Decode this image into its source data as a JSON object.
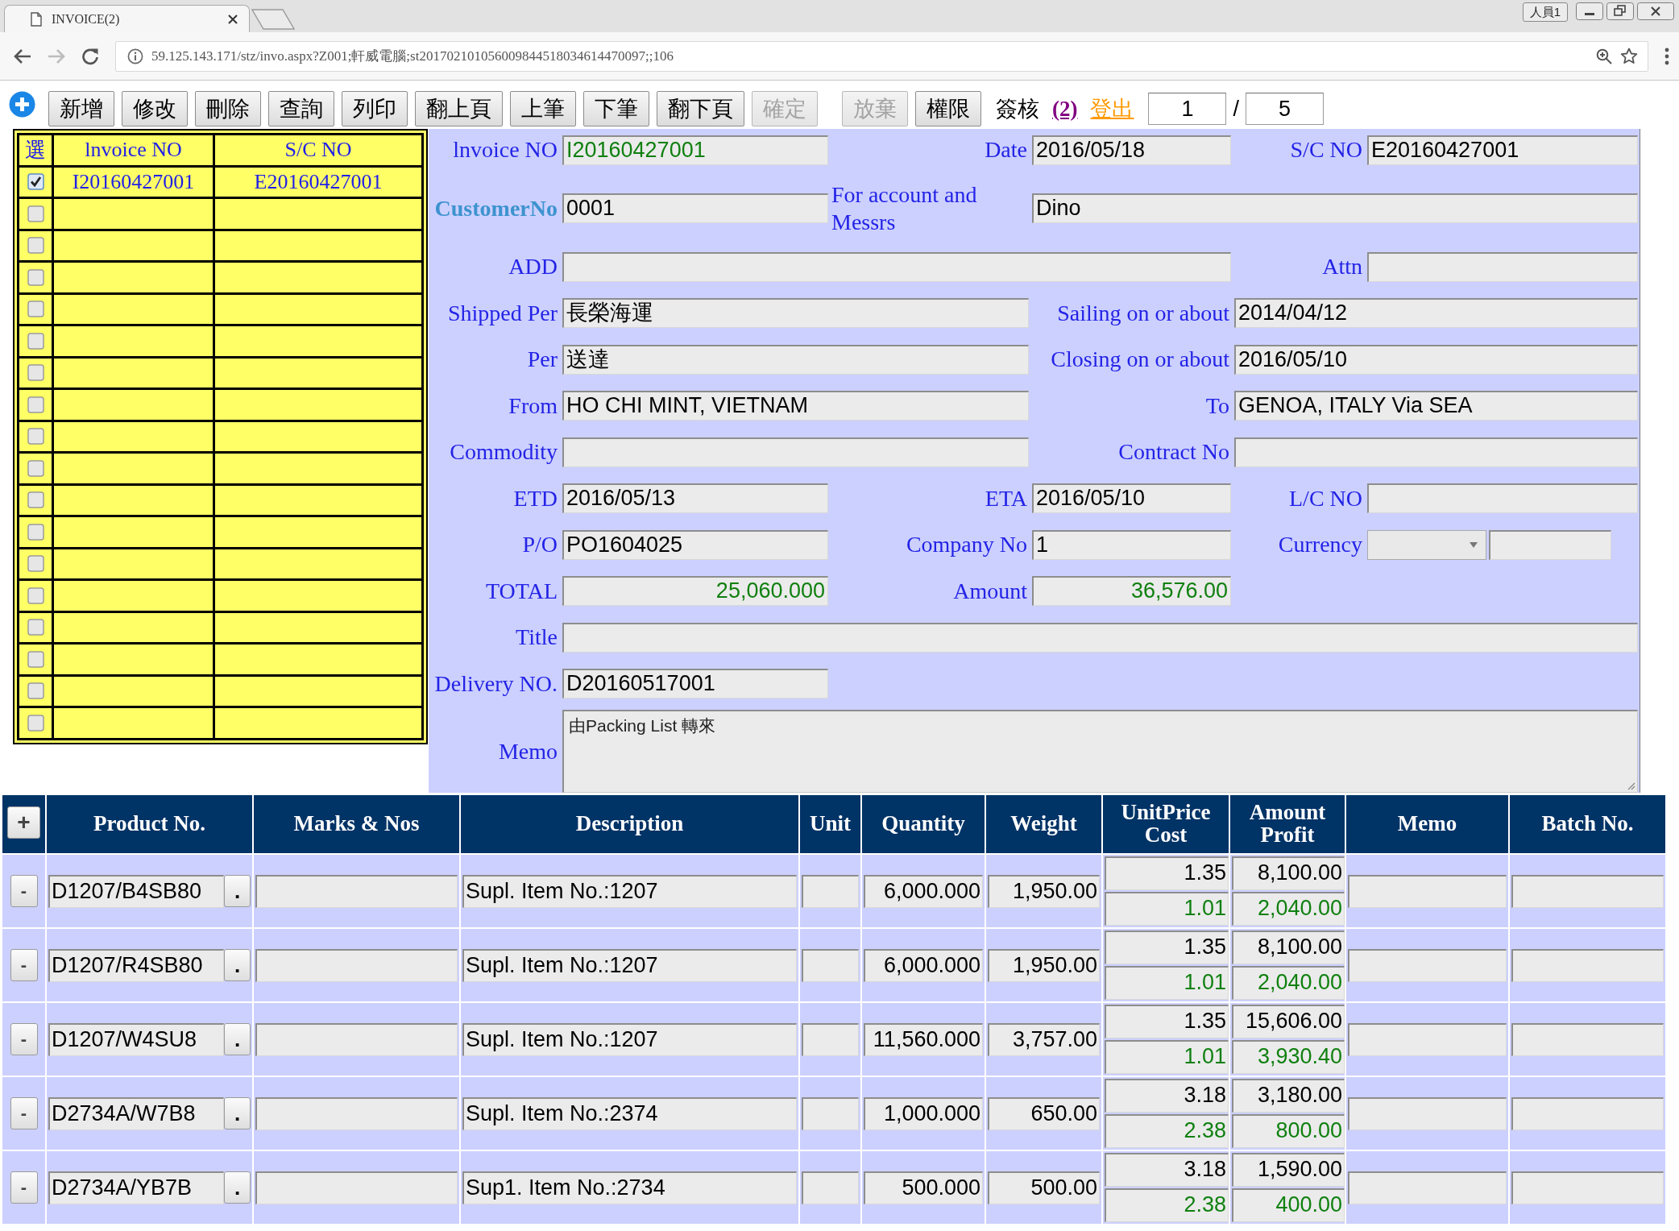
{
  "browser": {
    "tab_title": "INVOICE(2)",
    "profile": "人員1",
    "url": "59.125.143.171/stz/invo.aspx?Z001;軒威電腦;st201702101056009844518034614470097;;106"
  },
  "toolbar": {
    "buttons": [
      {
        "label": "新增",
        "disabled": false
      },
      {
        "label": "修改",
        "disabled": false
      },
      {
        "label": "刪除",
        "disabled": false
      },
      {
        "label": "查詢",
        "disabled": false
      },
      {
        "label": "列印",
        "disabled": false
      },
      {
        "label": "翻上頁",
        "disabled": false
      },
      {
        "label": "上筆",
        "disabled": false
      },
      {
        "label": "下筆",
        "disabled": false
      },
      {
        "label": "翻下頁",
        "disabled": false
      },
      {
        "label": "確定",
        "disabled": true
      },
      {
        "label": "放棄",
        "disabled": true
      },
      {
        "label": "權限",
        "disabled": false
      }
    ],
    "approval_label": "簽核",
    "links": [
      {
        "label": "(2)",
        "color": "#800080"
      },
      {
        "label": "登出",
        "color": "#ff9900"
      }
    ],
    "pager": {
      "current": "1",
      "separator": "/",
      "total": "5"
    }
  },
  "record_list": {
    "columns": [
      "選",
      "lnvoice NO",
      "S/C NO"
    ],
    "rows": [
      {
        "checked": true,
        "invoice_no": "I20160427001",
        "sc_no": "E20160427001"
      },
      {
        "checked": false
      },
      {
        "checked": false
      },
      {
        "checked": false
      },
      {
        "checked": false
      },
      {
        "checked": false
      },
      {
        "checked": false
      },
      {
        "checked": false
      },
      {
        "checked": false
      },
      {
        "checked": false
      },
      {
        "checked": false
      },
      {
        "checked": false
      },
      {
        "checked": false
      },
      {
        "checked": false
      },
      {
        "checked": false
      },
      {
        "checked": false
      },
      {
        "checked": false
      },
      {
        "checked": false
      }
    ]
  },
  "form": {
    "rows": [
      {
        "fields": [
          {
            "label": "lnvoice NO",
            "label_is_link": false,
            "value": "I20160427001",
            "kind": "text",
            "color": "#108010"
          },
          {
            "label": "Date",
            "label_is_link": false,
            "value": "2016/05/18",
            "kind": "text"
          },
          {
            "label": "S/C NO",
            "label_is_link": false,
            "value": "E20160427001",
            "kind": "text"
          }
        ]
      },
      {
        "fields": [
          {
            "label": "CustomerNo",
            "label_is_link": true,
            "value": "0001",
            "kind": "text"
          },
          {
            "label": "For account and Messrs",
            "label_is_link": false,
            "value": "Dino",
            "kind": "text"
          }
        ]
      },
      {
        "fields": [
          {
            "label": "ADD",
            "label_is_link": false,
            "kind": "text"
          },
          {
            "label": "Attn",
            "label_is_link": false,
            "kind": "text"
          }
        ]
      },
      {
        "fields": [
          {
            "label": "Shipped Per",
            "label_is_link": false,
            "value": "長榮海運",
            "kind": "text"
          },
          {
            "label": "Sailing on or about",
            "label_is_link": false,
            "value": "2014/04/12",
            "kind": "text"
          }
        ]
      },
      {
        "fields": [
          {
            "label": "Per",
            "label_is_link": false,
            "value": "送達",
            "kind": "text"
          },
          {
            "label": "Closing on or about",
            "label_is_link": false,
            "value": "2016/05/10",
            "kind": "text"
          }
        ]
      },
      {
        "fields": [
          {
            "label": "From",
            "label_is_link": false,
            "value": "HO CHI MINT, VIETNAM",
            "kind": "text"
          },
          {
            "label": "To",
            "label_is_link": false,
            "value": "GENOA, ITALY Via SEA",
            "kind": "text"
          }
        ]
      },
      {
        "fields": [
          {
            "label": "Commodity",
            "label_is_link": false,
            "kind": "text"
          },
          {
            "label": "Contract No",
            "label_is_link": false,
            "kind": "text"
          }
        ]
      },
      {
        "fields": [
          {
            "label": "ETD",
            "label_is_link": false,
            "value": "2016/05/13",
            "kind": "text"
          },
          {
            "label": "ETA",
            "label_is_link": false,
            "value": "2016/05/10",
            "kind": "text"
          },
          {
            "label": "L/C NO",
            "label_is_link": false,
            "kind": "text"
          }
        ]
      },
      {
        "fields": [
          {
            "label": "P/O",
            "label_is_link": false,
            "value": "PO1604025",
            "kind": "text"
          },
          {
            "label": "Company No",
            "label_is_link": false,
            "value": "1",
            "kind": "text"
          },
          {
            "label": "Currency",
            "label_is_link": false,
            "kind": "select"
          }
        ]
      },
      {
        "fields": [
          {
            "label": "TOTAL",
            "label_is_link": false,
            "value": "25,060.000",
            "kind": "number",
            "color": "#108010"
          },
          {
            "label": "Amount",
            "label_is_link": false,
            "value": "36,576.00",
            "kind": "number",
            "color": "#108010"
          }
        ]
      },
      {
        "fields": [
          {
            "label": "Title",
            "label_is_link": false,
            "kind": "text"
          }
        ]
      },
      {
        "fields": [
          {
            "label": "Delivery NO.",
            "label_is_link": false,
            "value": "D20160517001",
            "kind": "text"
          }
        ]
      },
      {
        "fields": [
          {
            "label": "Memo",
            "label_is_link": false,
            "value": "由Packing List 轉來",
            "kind": "textarea"
          }
        ]
      }
    ]
  },
  "products": {
    "add_button": "+",
    "columns": [
      {
        "label": "Product No."
      },
      {
        "label": "Marks & Nos"
      },
      {
        "label": "Description"
      },
      {
        "label": "Unit"
      },
      {
        "label": "Quantity"
      },
      {
        "label": "Weight"
      },
      {
        "label": "UnitPrice",
        "sublabel": "Cost"
      },
      {
        "label": "Amount",
        "sublabel": "Profit"
      },
      {
        "label": "Memo"
      },
      {
        "label": "Batch No."
      }
    ],
    "rows": [
      {
        "remove_button": "-",
        "product_no": "D1207/B4SB80",
        "lookup_button": ".",
        "description": "Supl. Item No.:1207",
        "quantity": "6,000.000",
        "weight": "1,950.00",
        "unit_price": "1.35",
        "cost": "1.01",
        "amount": "8,100.00",
        "profit": "2,040.00"
      },
      {
        "remove_button": "-",
        "product_no": "D1207/R4SB80",
        "lookup_button": ".",
        "description": "Supl. Item No.:1207",
        "quantity": "6,000.000",
        "weight": "1,950.00",
        "unit_price": "1.35",
        "cost": "1.01",
        "amount": "8,100.00",
        "profit": "2,040.00"
      },
      {
        "remove_button": "-",
        "product_no": "D1207/W4SU8",
        "lookup_button": ".",
        "description": "Supl. Item No.:1207",
        "quantity": "11,560.000",
        "weight": "3,757.00",
        "unit_price": "1.35",
        "cost": "1.01",
        "amount": "15,606.00",
        "profit": "3,930.40"
      },
      {
        "remove_button": "-",
        "product_no": "D2734A/W7B8",
        "lookup_button": ".",
        "description": "Supl. Item No.:2374",
        "quantity": "1,000.000",
        "weight": "650.00",
        "unit_price": "3.18",
        "cost": "2.38",
        "amount": "3,180.00",
        "profit": "800.00"
      },
      {
        "remove_button": "-",
        "product_no": "D2734A/YB7B",
        "lookup_button": ".",
        "description": "Sup1. Item No.:2734",
        "quantity": "500.000",
        "weight": "500.00",
        "unit_price": "3.18",
        "cost": "2.38",
        "amount": "1,590.00",
        "profit": "400.00"
      }
    ]
  }
}
